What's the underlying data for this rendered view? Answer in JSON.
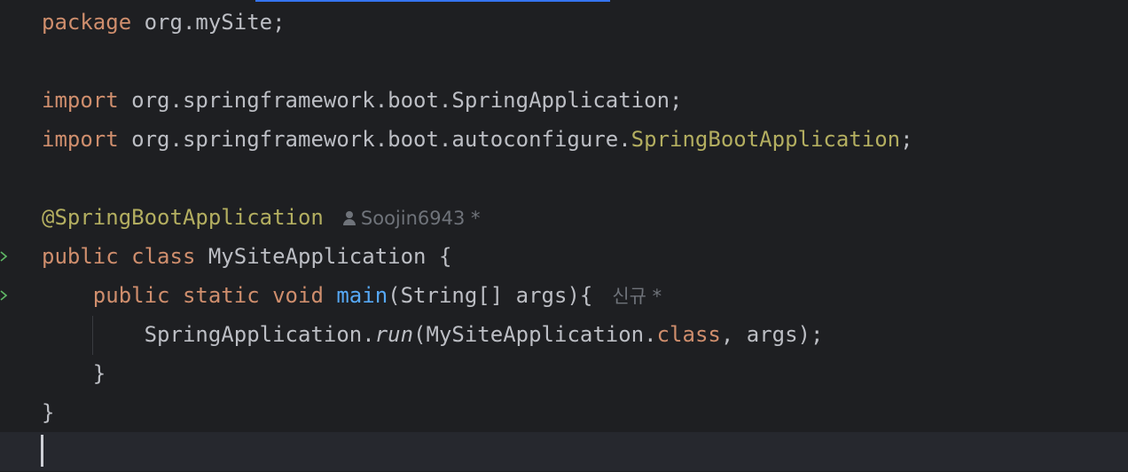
{
  "code": {
    "l1": {
      "kw": "package",
      "rest": " org.mySite;"
    },
    "l3": {
      "kw": "import",
      "rest": " org.springframework.boot.SpringApplication;"
    },
    "l4": {
      "kw": "import",
      "pre": " org.springframework.boot.autoconfigure.",
      "ann": "SpringBootApplication",
      "post": ";"
    },
    "l6": {
      "ann": "@SpringBootApplication",
      "inlay_author": "Soojin6943 *"
    },
    "l7": {
      "kw1": "public",
      "kw2": "class",
      "rest": " MySiteApplication {"
    },
    "l8": {
      "kw1": "public",
      "kw2": "static",
      "kw3": "void",
      "fn": "main",
      "rest": "(String[] args){",
      "inlay_author": "신규 *"
    },
    "l9": {
      "pre": "SpringApplication.",
      "method": "run",
      "mid": "(MySiteApplication.",
      "kw": "class",
      "post": ", args);"
    },
    "l10": {
      "text": "}"
    },
    "l11": {
      "text": "}"
    }
  },
  "colors": {
    "background": "#1e1f22",
    "keyword": "#cf8e6d",
    "annotation": "#b3ae60",
    "function": "#56a8f5",
    "default_text": "#bcbec4",
    "inlay_hint": "#6f737a",
    "run_gutter": "#5fb865"
  },
  "icons": {
    "author_hint": "user-icon",
    "gutter_run": "run-arrow-icon"
  }
}
